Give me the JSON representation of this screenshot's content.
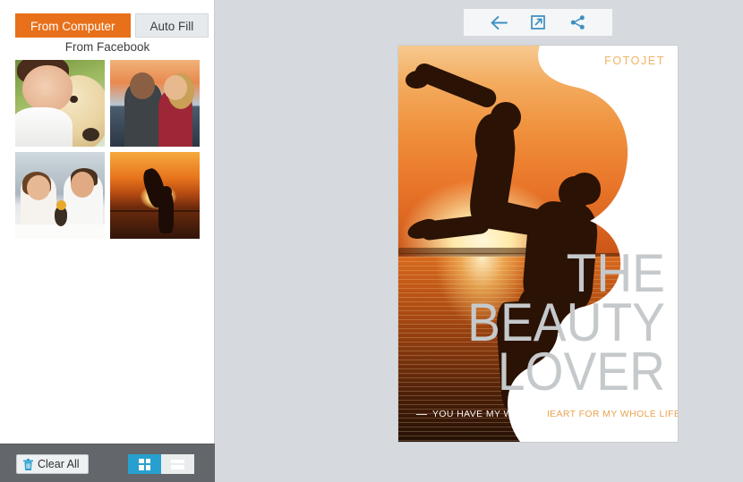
{
  "sidebar": {
    "tabs": [
      {
        "label": "From Computer",
        "active": true
      },
      {
        "label": "Auto Fill",
        "active": false
      }
    ],
    "source_link": "From Facebook",
    "thumbnails": [
      {
        "name": "woman-with-dog"
      },
      {
        "name": "couple-embracing-sunset"
      },
      {
        "name": "couple-at-table"
      },
      {
        "name": "silhouette-couple-jumping-sunset"
      }
    ],
    "bottom": {
      "clear_all_label": "Clear All",
      "trash_icon": "trash-icon",
      "view_modes": [
        {
          "name": "grid-view",
          "icon": "grid-icon",
          "active": true
        },
        {
          "name": "list-view",
          "icon": "list-icon",
          "active": false
        }
      ]
    }
  },
  "toolbar": {
    "items": [
      {
        "name": "back-button",
        "icon": "arrow-left-icon"
      },
      {
        "name": "export-button",
        "icon": "external-link-icon"
      },
      {
        "name": "share-button",
        "icon": "share-icon"
      }
    ]
  },
  "poster": {
    "brand": "FOTOJET",
    "title_lines": [
      "THE",
      "BEAUTY",
      "LOVER"
    ],
    "tagline": "YOU HAVE MY WHOLE HEART FOR MY WHOLE LIFE",
    "image_description": "silhouette-couple-jumping-sunset"
  },
  "colors": {
    "accent_orange": "#e8701a",
    "toggle_blue": "#28a0cf",
    "canvas_gray": "#d6dade",
    "bottom_bar_gray": "#63666a",
    "brand_gold": "#f0b264",
    "title_gray": "#c6c9cb"
  }
}
